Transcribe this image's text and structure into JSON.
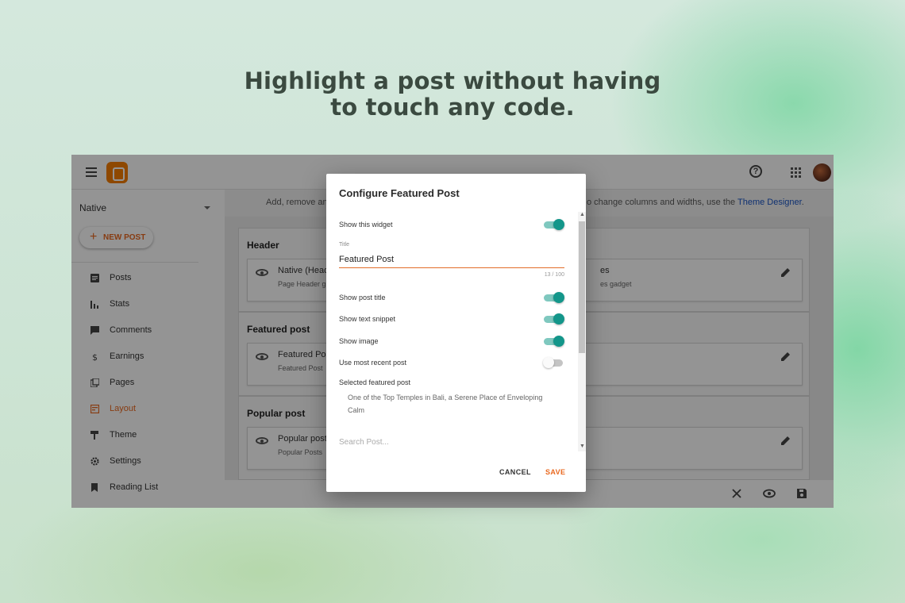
{
  "headline": {
    "line1": "Highlight a post without having",
    "line2": "to touch any code."
  },
  "colors": {
    "accent": "#e9681f",
    "toggle_on": "#13968a",
    "link": "#1a55c4"
  },
  "topbar": {
    "icons": [
      "menu-icon",
      "blogger-logo",
      "help-icon",
      "apps-icon",
      "avatar"
    ]
  },
  "sidebar": {
    "blog_name": "Native",
    "new_post_label": "NEW POST",
    "items": [
      {
        "label": "Posts",
        "icon": "posts-icon"
      },
      {
        "label": "Stats",
        "icon": "stats-icon"
      },
      {
        "label": "Comments",
        "icon": "comments-icon"
      },
      {
        "label": "Earnings",
        "icon": "dollar-icon"
      },
      {
        "label": "Pages",
        "icon": "pages-icon"
      },
      {
        "label": "Layout",
        "icon": "layout-icon",
        "active": true
      },
      {
        "label": "Theme",
        "icon": "paint-roller-icon"
      },
      {
        "label": "Settings",
        "icon": "gear-icon"
      },
      {
        "label": "Reading List",
        "icon": "bookmark-icon"
      }
    ]
  },
  "layout_info": {
    "left": "Add, remove an",
    "right": "o change columns and widths, use the",
    "link": "Theme Designer",
    "end": "."
  },
  "sections": [
    {
      "title": "Header",
      "gadgets": [
        {
          "name": "Native (Head",
          "sub": "Page Header g"
        },
        {
          "name": "es",
          "sub": "es gadget"
        }
      ]
    },
    {
      "title": "Featured post",
      "gadgets": [
        {
          "name": "Featured Pos",
          "sub": "Featured Post"
        }
      ]
    },
    {
      "title": "Popular post",
      "gadgets": [
        {
          "name": "Popular post",
          "sub": "Popular Posts"
        }
      ]
    }
  ],
  "dialog": {
    "title": "Configure Featured Post",
    "show_widget": {
      "label": "Show this widget",
      "on": true
    },
    "title_field": {
      "label": "Title",
      "value": "Featured Post",
      "count": "13 / 100"
    },
    "options": [
      {
        "label": "Show post title",
        "on": true
      },
      {
        "label": "Show text snippet",
        "on": true
      },
      {
        "label": "Show image",
        "on": true
      },
      {
        "label": "Use most recent post",
        "on": false
      }
    ],
    "selected_label": "Selected featured post",
    "selected_value": "One of the Top Temples in Bali, a Serene Place of Enveloping Calm",
    "search_placeholder": "Search Post...",
    "cancel_label": "CANCEL",
    "save_label": "SAVE"
  }
}
